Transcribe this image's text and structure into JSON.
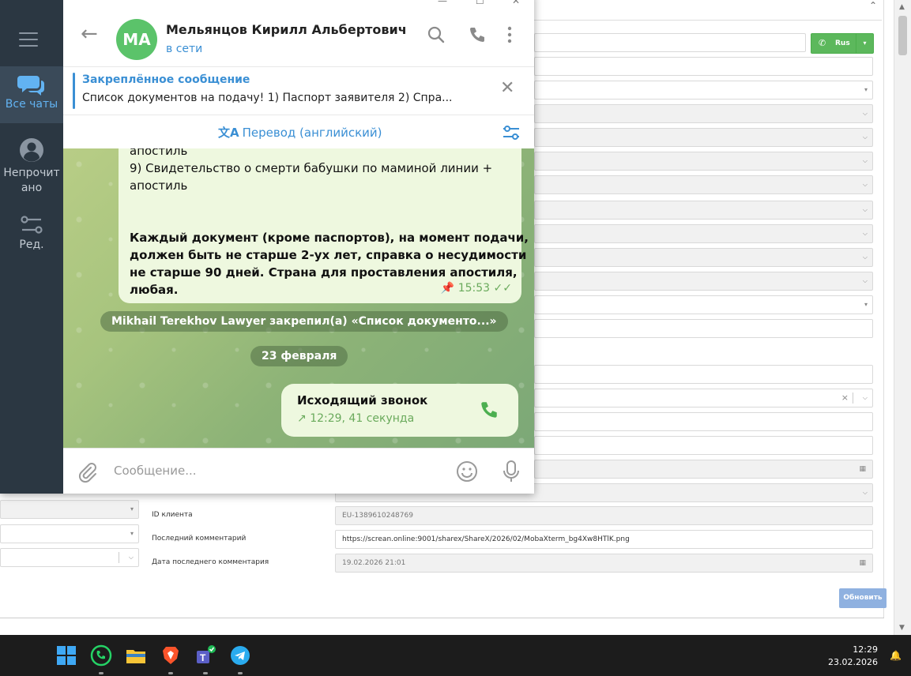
{
  "telegram": {
    "window_controls": {
      "minimize": "—",
      "maximize": "☐",
      "close": "✕"
    },
    "sidebar": {
      "items": [
        {
          "label": "Все чаты",
          "icon": "chats-icon"
        },
        {
          "label": "Непрочитано",
          "icon": "user-circle-icon"
        },
        {
          "label": "Ред.",
          "icon": "edit-filters-icon"
        }
      ]
    },
    "header": {
      "avatar_initials": "МА",
      "name": "Мельянцов Кирилл Альбертович",
      "status": "в сети",
      "avatar_color": "#5bc36a"
    },
    "pinned": {
      "title": "Закреплённое сообщение",
      "text": "Список документов на подачу!  1) Паспорт заявителя  2) Спра..."
    },
    "translate": {
      "label": "Перевод (английский)",
      "glyph": "文A"
    },
    "messages": {
      "incoming_lines": [
        "апостиль",
        "9) Свидетельство о смерти бабушки по маминой линии +",
        "апостиль"
      ],
      "incoming_bold_lines": [
        "Каждый документ (кроме паспортов), на момент подачи,",
        "должен быть не старше 2-ух лет, справка о несудимости",
        "не старше 90 дней. Страна для проставления апостиля,",
        "любая."
      ],
      "incoming_time": "15:53",
      "service_pinned": "Mikhail Terekhov Lawyer закрепил(а) «Список документо...»",
      "date_divider": "23 февраля",
      "call_title": "Исходящий звонок",
      "call_details": "12:29, 41 секунда"
    },
    "composer": {
      "placeholder": "Сообщение..."
    }
  },
  "crm": {
    "lang_button": "Rus",
    "rows": [
      {
        "label": "ID клиента",
        "value": "EU-1389610248769"
      },
      {
        "label": "Последний комментарий",
        "value": "https://screan.online:9001/sharex/ShareX/2026/02/MobaXterm_bg4Xw8HTlK.png"
      },
      {
        "label": "Дата последнего комментария",
        "value": "19.02.2026 21:01"
      }
    ],
    "update_button": "Обновить"
  },
  "taskbar": {
    "time": "12:29",
    "date": "23.02.2026"
  }
}
